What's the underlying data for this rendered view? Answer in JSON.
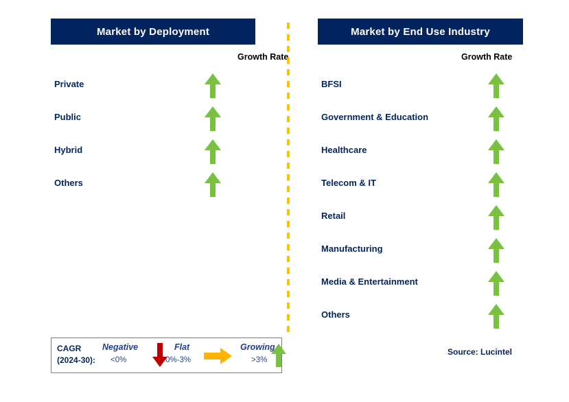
{
  "colors": {
    "header_bg": "#03245e",
    "label_navy": "#03245e",
    "arrow_green": "#7ac143",
    "arrow_red": "#c00000",
    "arrow_amber": "#ffb400",
    "divider_yellow": "#ffc200",
    "legend_border": "#7f7f7f",
    "legend_term": "#1f3f93"
  },
  "panels": [
    {
      "id": "deployment",
      "title": "Market by Deployment",
      "growth_rate_label": "Growth Rate",
      "rows": [
        {
          "label": "Private",
          "growth": "growing",
          "icon": "up-arrow-icon"
        },
        {
          "label": "Public",
          "growth": "growing",
          "icon": "up-arrow-icon"
        },
        {
          "label": "Hybrid",
          "growth": "growing",
          "icon": "up-arrow-icon"
        },
        {
          "label": "Others",
          "growth": "growing",
          "icon": "up-arrow-icon"
        }
      ]
    },
    {
      "id": "end-use-industry",
      "title": "Market by End Use Industry",
      "growth_rate_label": "Growth Rate",
      "rows": [
        {
          "label": "BFSI",
          "growth": "growing",
          "icon": "up-arrow-icon"
        },
        {
          "label": "Government & Education",
          "growth": "growing",
          "icon": "up-arrow-icon"
        },
        {
          "label": "Healthcare",
          "growth": "growing",
          "icon": "up-arrow-icon"
        },
        {
          "label": "Telecom & IT",
          "growth": "growing",
          "icon": "up-arrow-icon"
        },
        {
          "label": "Retail",
          "growth": "growing",
          "icon": "up-arrow-icon"
        },
        {
          "label": "Manufacturing",
          "growth": "growing",
          "icon": "up-arrow-icon"
        },
        {
          "label": "Media & Entertainment",
          "growth": "growing",
          "icon": "up-arrow-icon"
        },
        {
          "label": "Others",
          "growth": "growing",
          "icon": "up-arrow-icon"
        }
      ]
    }
  ],
  "legend": {
    "title_line1": "CAGR",
    "title_line2": "(2024-30):",
    "items": [
      {
        "term": "Negative",
        "value": "<0%",
        "icon": "down-arrow-icon"
      },
      {
        "term": "Flat",
        "value": "0%-3%",
        "icon": "right-arrow-icon"
      },
      {
        "term": "Growing",
        "value": ">3%",
        "icon": "up-arrow-icon"
      }
    ]
  },
  "source": "Source: Lucintel",
  "chart_data": {
    "type": "table",
    "title": "Cloud market growth rate by segment",
    "legend": {
      "measure": "CAGR (2024-30)",
      "bands": [
        {
          "name": "Negative",
          "range": "<0%",
          "symbol": "down arrow",
          "color": "#c00000"
        },
        {
          "name": "Flat",
          "range": "0%-3%",
          "symbol": "right arrow",
          "color": "#ffb400"
        },
        {
          "name": "Growing",
          "range": ">3%",
          "symbol": "up arrow",
          "color": "#7ac143"
        }
      ]
    },
    "sections": [
      {
        "name": "Market by Deployment",
        "columns": [
          "Segment",
          "Growth Rate"
        ],
        "rows": [
          [
            "Private",
            "Growing (>3%)"
          ],
          [
            "Public",
            "Growing (>3%)"
          ],
          [
            "Hybrid",
            "Growing (>3%)"
          ],
          [
            "Others",
            "Growing (>3%)"
          ]
        ]
      },
      {
        "name": "Market by End Use Industry",
        "columns": [
          "Segment",
          "Growth Rate"
        ],
        "rows": [
          [
            "BFSI",
            "Growing (>3%)"
          ],
          [
            "Government & Education",
            "Growing (>3%)"
          ],
          [
            "Healthcare",
            "Growing (>3%)"
          ],
          [
            "Telecom & IT",
            "Growing (>3%)"
          ],
          [
            "Retail",
            "Growing (>3%)"
          ],
          [
            "Manufacturing",
            "Growing (>3%)"
          ],
          [
            "Media & Entertainment",
            "Growing (>3%)"
          ],
          [
            "Others",
            "Growing (>3%)"
          ]
        ]
      }
    ],
    "source": "Lucintel"
  }
}
